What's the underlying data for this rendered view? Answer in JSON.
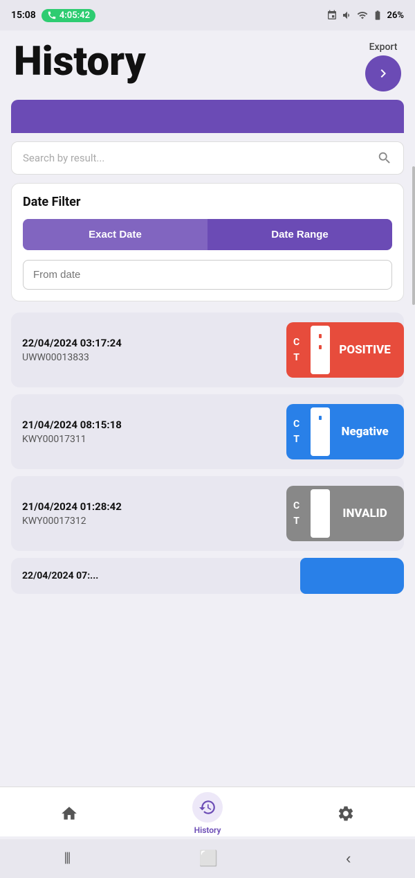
{
  "statusBar": {
    "time": "15:08",
    "callDuration": "4:05:42",
    "battery": "26%"
  },
  "header": {
    "title": "History",
    "exportLabel": "Export"
  },
  "search": {
    "placeholder": "Search by result..."
  },
  "dateFilter": {
    "title": "Date Filter",
    "exactDateLabel": "Exact Date",
    "dateRangeLabel": "Date Range",
    "fromDatePlaceholder": "From date"
  },
  "results": [
    {
      "datetime": "22/04/2024 03:17:24",
      "code": "UWW00013833",
      "status": "POSITIVE",
      "badgeType": "positive"
    },
    {
      "datetime": "21/04/2024 08:15:18",
      "code": "KWY00017311",
      "status": "NEGATIVE",
      "badgeType": "negative"
    },
    {
      "datetime": "21/04/2024 01:28:42",
      "code": "KWY00017312",
      "status": "INVALID",
      "badgeType": "invalid"
    }
  ],
  "partialCard": {
    "datetime": "22/04/2024 07:..."
  },
  "bottomNav": {
    "items": [
      {
        "id": "home",
        "label": "Home",
        "active": false
      },
      {
        "id": "history",
        "label": "History",
        "active": true
      },
      {
        "id": "settings",
        "label": "",
        "active": false
      }
    ]
  },
  "androidNav": {
    "recentLabel": "⦀",
    "homeLabel": "⬜",
    "backLabel": "‹"
  }
}
